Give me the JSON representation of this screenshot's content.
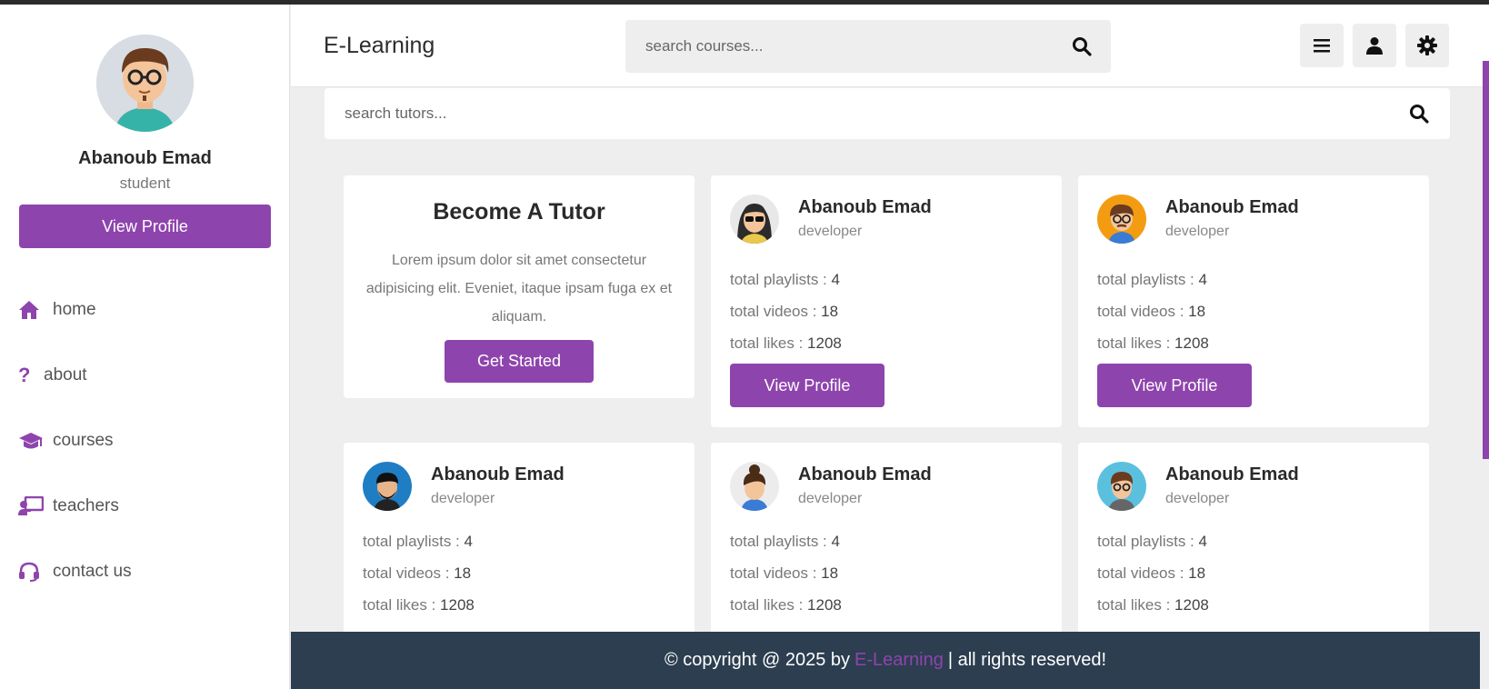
{
  "sidebar": {
    "user_name": "Abanoub Emad",
    "user_role": "student",
    "view_profile_label": "View Profile",
    "nav": [
      {
        "label": "home",
        "icon": "home-icon"
      },
      {
        "label": "about",
        "icon": "question-icon"
      },
      {
        "label": "courses",
        "icon": "graduation-cap-icon"
      },
      {
        "label": "teachers",
        "icon": "chalkboard-teacher-icon"
      },
      {
        "label": "contact us",
        "icon": "headset-icon"
      }
    ]
  },
  "header": {
    "logo": "E-Learning",
    "search_placeholder": "search courses...",
    "buttons": [
      "menu-icon",
      "user-icon",
      "gear-icon"
    ]
  },
  "tutors": {
    "search_placeholder": "search tutors...",
    "become": {
      "title": "Become A Tutor",
      "text": "Lorem ipsum dolor sit amet consectetur adipisicing elit. Eveniet, itaque ipsam fuga ex et aliquam.",
      "button": "Get Started"
    },
    "stat_labels": {
      "playlists": "total playlists : ",
      "videos": "total videos : ",
      "likes": "total likes : "
    },
    "view_profile_label": "View Profile",
    "cards": [
      {
        "name": "Abanoub Emad",
        "role": "developer",
        "playlists": "4",
        "videos": "18",
        "likes": "1208"
      },
      {
        "name": "Abanoub Emad",
        "role": "developer",
        "playlists": "4",
        "videos": "18",
        "likes": "1208"
      },
      {
        "name": "Abanoub Emad",
        "role": "developer",
        "playlists": "4",
        "videos": "18",
        "likes": "1208"
      },
      {
        "name": "Abanoub Emad",
        "role": "developer",
        "playlists": "4",
        "videos": "18",
        "likes": "1208"
      },
      {
        "name": "Abanoub Emad",
        "role": "developer",
        "playlists": "4",
        "videos": "18",
        "likes": "1208"
      }
    ]
  },
  "footer": {
    "prefix": "© copyright @ 2025 by",
    "brand": "E-Learning",
    "suffix": "| all rights reserved!"
  },
  "colors": {
    "accent": "#8e44ad",
    "footer_bg": "#2c3e50",
    "page_bg": "#eeeeee"
  }
}
